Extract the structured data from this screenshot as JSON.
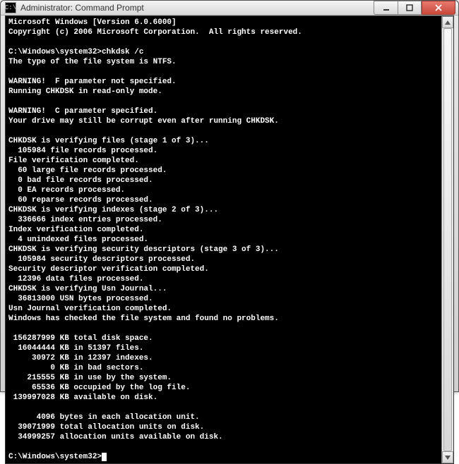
{
  "window": {
    "icon_label": "C:\\",
    "title": "Administrator: Command Prompt"
  },
  "console": {
    "lines": [
      "Microsoft Windows [Version 6.0.6000]",
      "Copyright (c) 2006 Microsoft Corporation.  All rights reserved.",
      "",
      "C:\\Windows\\system32>chkdsk /c",
      "The type of the file system is NTFS.",
      "",
      "WARNING!  F parameter not specified.",
      "Running CHKDSK in read-only mode.",
      "",
      "WARNING!  C parameter specified.",
      "Your drive may still be corrupt even after running CHKDSK.",
      "",
      "CHKDSK is verifying files (stage 1 of 3)...",
      "  105984 file records processed.",
      "File verification completed.",
      "  60 large file records processed.",
      "  0 bad file records processed.",
      "  0 EA records processed.",
      "  60 reparse records processed.",
      "CHKDSK is verifying indexes (stage 2 of 3)...",
      "  336666 index entries processed.",
      "Index verification completed.",
      "  4 unindexed files processed.",
      "CHKDSK is verifying security descriptors (stage 3 of 3)...",
      "  105984 security descriptors processed.",
      "Security descriptor verification completed.",
      "  12396 data files processed.",
      "CHKDSK is verifying Usn Journal...",
      "  36813000 USN bytes processed.",
      "Usn Journal verification completed.",
      "Windows has checked the file system and found no problems.",
      "",
      " 156287999 KB total disk space.",
      "  16044444 KB in 51397 files.",
      "     30972 KB in 12397 indexes.",
      "         0 KB in bad sectors.",
      "    215555 KB in use by the system.",
      "     65536 KB occupied by the log file.",
      " 139997028 KB available on disk.",
      "",
      "      4096 bytes in each allocation unit.",
      "  39071999 total allocation units on disk.",
      "  34999257 allocation units available on disk.",
      ""
    ],
    "prompt": "C:\\Windows\\system32>"
  }
}
